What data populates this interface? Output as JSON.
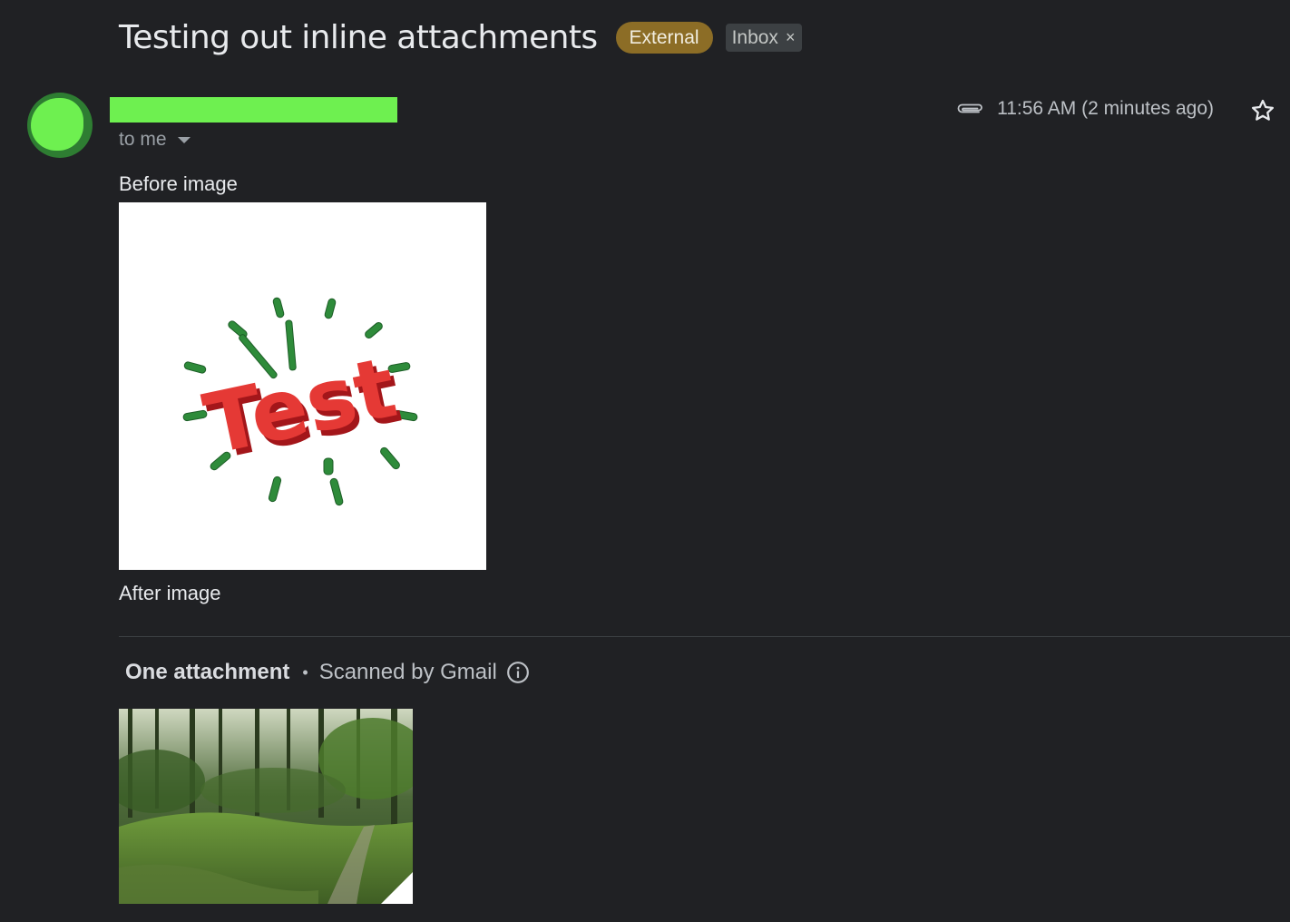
{
  "email": {
    "subject": "Testing out inline attachments",
    "labels": {
      "external": "External",
      "inbox": "Inbox",
      "remove_symbol": "×"
    },
    "recipient": "to me",
    "timestamp": "11:56 AM (2 minutes ago)",
    "body": {
      "before_text": "Before image",
      "after_text": "After image",
      "inline_image_text": "Test"
    },
    "attachments": {
      "title": "One attachment",
      "separator": "•",
      "scanned": "Scanned by Gmail"
    }
  },
  "icons": {
    "attachment": "paperclip-icon",
    "star": "star-icon",
    "info": "info-icon",
    "dropdown": "caret-down-icon"
  },
  "colors": {
    "background": "#202124",
    "external_label": "#8c6d26",
    "inbox_label": "#3c4043",
    "avatar": "#2e7d32",
    "redaction": "#6ef050"
  }
}
